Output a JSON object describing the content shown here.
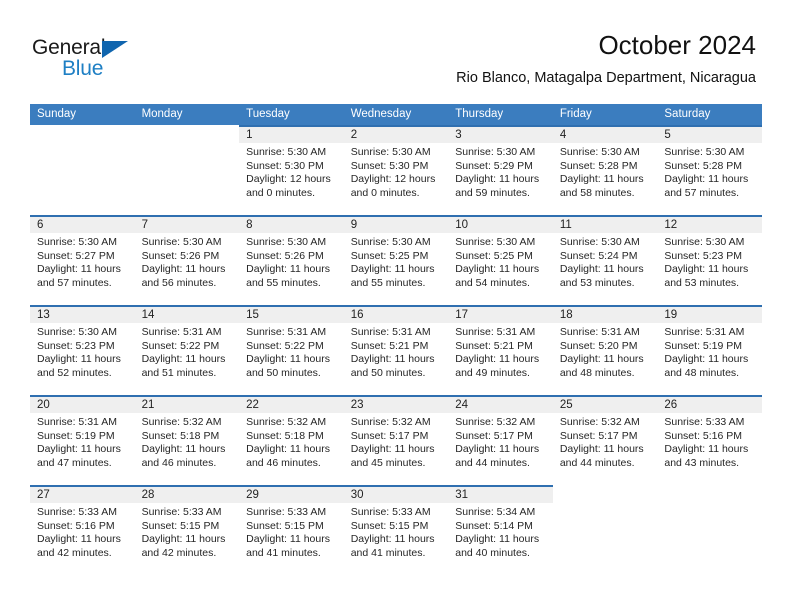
{
  "brand": {
    "name_part1": "General",
    "name_part2": "Blue",
    "accent_color": "#1e7fc4",
    "triangle_color": "#1065ae"
  },
  "header": {
    "title": "October 2024",
    "subtitle": "Rio Blanco, Matagalpa Department, Nicaragua"
  },
  "theme": {
    "header_blue": "#3b7dbf",
    "separator_blue": "#2f6fb0",
    "day_band_gray": "#efefef"
  },
  "weekdays": [
    "Sunday",
    "Monday",
    "Tuesday",
    "Wednesday",
    "Thursday",
    "Friday",
    "Saturday"
  ],
  "weeks": [
    [
      {
        "empty": true
      },
      {
        "empty": true
      },
      {
        "day": "1",
        "sunrise": "Sunrise: 5:30 AM",
        "sunset": "Sunset: 5:30 PM",
        "daylight1": "Daylight: 12 hours",
        "daylight2": "and 0 minutes."
      },
      {
        "day": "2",
        "sunrise": "Sunrise: 5:30 AM",
        "sunset": "Sunset: 5:30 PM",
        "daylight1": "Daylight: 12 hours",
        "daylight2": "and 0 minutes."
      },
      {
        "day": "3",
        "sunrise": "Sunrise: 5:30 AM",
        "sunset": "Sunset: 5:29 PM",
        "daylight1": "Daylight: 11 hours",
        "daylight2": "and 59 minutes."
      },
      {
        "day": "4",
        "sunrise": "Sunrise: 5:30 AM",
        "sunset": "Sunset: 5:28 PM",
        "daylight1": "Daylight: 11 hours",
        "daylight2": "and 58 minutes."
      },
      {
        "day": "5",
        "sunrise": "Sunrise: 5:30 AM",
        "sunset": "Sunset: 5:28 PM",
        "daylight1": "Daylight: 11 hours",
        "daylight2": "and 57 minutes."
      }
    ],
    [
      {
        "day": "6",
        "sunrise": "Sunrise: 5:30 AM",
        "sunset": "Sunset: 5:27 PM",
        "daylight1": "Daylight: 11 hours",
        "daylight2": "and 57 minutes."
      },
      {
        "day": "7",
        "sunrise": "Sunrise: 5:30 AM",
        "sunset": "Sunset: 5:26 PM",
        "daylight1": "Daylight: 11 hours",
        "daylight2": "and 56 minutes."
      },
      {
        "day": "8",
        "sunrise": "Sunrise: 5:30 AM",
        "sunset": "Sunset: 5:26 PM",
        "daylight1": "Daylight: 11 hours",
        "daylight2": "and 55 minutes."
      },
      {
        "day": "9",
        "sunrise": "Sunrise: 5:30 AM",
        "sunset": "Sunset: 5:25 PM",
        "daylight1": "Daylight: 11 hours",
        "daylight2": "and 55 minutes."
      },
      {
        "day": "10",
        "sunrise": "Sunrise: 5:30 AM",
        "sunset": "Sunset: 5:25 PM",
        "daylight1": "Daylight: 11 hours",
        "daylight2": "and 54 minutes."
      },
      {
        "day": "11",
        "sunrise": "Sunrise: 5:30 AM",
        "sunset": "Sunset: 5:24 PM",
        "daylight1": "Daylight: 11 hours",
        "daylight2": "and 53 minutes."
      },
      {
        "day": "12",
        "sunrise": "Sunrise: 5:30 AM",
        "sunset": "Sunset: 5:23 PM",
        "daylight1": "Daylight: 11 hours",
        "daylight2": "and 53 minutes."
      }
    ],
    [
      {
        "day": "13",
        "sunrise": "Sunrise: 5:30 AM",
        "sunset": "Sunset: 5:23 PM",
        "daylight1": "Daylight: 11 hours",
        "daylight2": "and 52 minutes."
      },
      {
        "day": "14",
        "sunrise": "Sunrise: 5:31 AM",
        "sunset": "Sunset: 5:22 PM",
        "daylight1": "Daylight: 11 hours",
        "daylight2": "and 51 minutes."
      },
      {
        "day": "15",
        "sunrise": "Sunrise: 5:31 AM",
        "sunset": "Sunset: 5:22 PM",
        "daylight1": "Daylight: 11 hours",
        "daylight2": "and 50 minutes."
      },
      {
        "day": "16",
        "sunrise": "Sunrise: 5:31 AM",
        "sunset": "Sunset: 5:21 PM",
        "daylight1": "Daylight: 11 hours",
        "daylight2": "and 50 minutes."
      },
      {
        "day": "17",
        "sunrise": "Sunrise: 5:31 AM",
        "sunset": "Sunset: 5:21 PM",
        "daylight1": "Daylight: 11 hours",
        "daylight2": "and 49 minutes."
      },
      {
        "day": "18",
        "sunrise": "Sunrise: 5:31 AM",
        "sunset": "Sunset: 5:20 PM",
        "daylight1": "Daylight: 11 hours",
        "daylight2": "and 48 minutes."
      },
      {
        "day": "19",
        "sunrise": "Sunrise: 5:31 AM",
        "sunset": "Sunset: 5:19 PM",
        "daylight1": "Daylight: 11 hours",
        "daylight2": "and 48 minutes."
      }
    ],
    [
      {
        "day": "20",
        "sunrise": "Sunrise: 5:31 AM",
        "sunset": "Sunset: 5:19 PM",
        "daylight1": "Daylight: 11 hours",
        "daylight2": "and 47 minutes."
      },
      {
        "day": "21",
        "sunrise": "Sunrise: 5:32 AM",
        "sunset": "Sunset: 5:18 PM",
        "daylight1": "Daylight: 11 hours",
        "daylight2": "and 46 minutes."
      },
      {
        "day": "22",
        "sunrise": "Sunrise: 5:32 AM",
        "sunset": "Sunset: 5:18 PM",
        "daylight1": "Daylight: 11 hours",
        "daylight2": "and 46 minutes."
      },
      {
        "day": "23",
        "sunrise": "Sunrise: 5:32 AM",
        "sunset": "Sunset: 5:17 PM",
        "daylight1": "Daylight: 11 hours",
        "daylight2": "and 45 minutes."
      },
      {
        "day": "24",
        "sunrise": "Sunrise: 5:32 AM",
        "sunset": "Sunset: 5:17 PM",
        "daylight1": "Daylight: 11 hours",
        "daylight2": "and 44 minutes."
      },
      {
        "day": "25",
        "sunrise": "Sunrise: 5:32 AM",
        "sunset": "Sunset: 5:17 PM",
        "daylight1": "Daylight: 11 hours",
        "daylight2": "and 44 minutes."
      },
      {
        "day": "26",
        "sunrise": "Sunrise: 5:33 AM",
        "sunset": "Sunset: 5:16 PM",
        "daylight1": "Daylight: 11 hours",
        "daylight2": "and 43 minutes."
      }
    ],
    [
      {
        "day": "27",
        "sunrise": "Sunrise: 5:33 AM",
        "sunset": "Sunset: 5:16 PM",
        "daylight1": "Daylight: 11 hours",
        "daylight2": "and 42 minutes."
      },
      {
        "day": "28",
        "sunrise": "Sunrise: 5:33 AM",
        "sunset": "Sunset: 5:15 PM",
        "daylight1": "Daylight: 11 hours",
        "daylight2": "and 42 minutes."
      },
      {
        "day": "29",
        "sunrise": "Sunrise: 5:33 AM",
        "sunset": "Sunset: 5:15 PM",
        "daylight1": "Daylight: 11 hours",
        "daylight2": "and 41 minutes."
      },
      {
        "day": "30",
        "sunrise": "Sunrise: 5:33 AM",
        "sunset": "Sunset: 5:15 PM",
        "daylight1": "Daylight: 11 hours",
        "daylight2": "and 41 minutes."
      },
      {
        "day": "31",
        "sunrise": "Sunrise: 5:34 AM",
        "sunset": "Sunset: 5:14 PM",
        "daylight1": "Daylight: 11 hours",
        "daylight2": "and 40 minutes."
      },
      {
        "empty": true
      },
      {
        "empty": true
      }
    ]
  ]
}
